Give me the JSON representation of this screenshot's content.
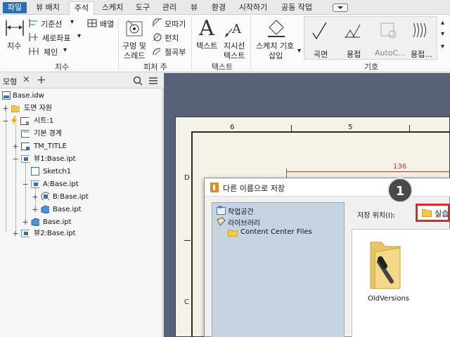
{
  "ribbon_tabs": [
    {
      "label": "파일",
      "active": false,
      "file": true
    },
    {
      "label": "뷰 배치",
      "active": false
    },
    {
      "label": "주석",
      "active": true
    },
    {
      "label": "스케치",
      "active": false
    },
    {
      "label": "도구",
      "active": false
    },
    {
      "label": "관리",
      "active": false
    },
    {
      "label": "뷰",
      "active": false
    },
    {
      "label": "환경",
      "active": false
    },
    {
      "label": "시작하기",
      "active": false
    },
    {
      "label": "공동 작업",
      "active": false
    }
  ],
  "ribbon": {
    "dimension": {
      "big_button": "치수",
      "baseline": "기준선",
      "ordinate": "세로좌표",
      "chain": "체인",
      "arrange": "배열",
      "group": "치수"
    },
    "feature_notes": {
      "hole_thread_1": "구멍 및",
      "hole_thread_2": "스레드",
      "chamfer": "모따기",
      "punch": "펀치",
      "bend": "절곡부",
      "group": "피처 주"
    },
    "text": {
      "text": "텍스트",
      "leader_1": "지시선",
      "leader_2": "텍스트",
      "group": "텍스트"
    },
    "symbols": {
      "sketch_symbol_1": "스케치 기호",
      "sketch_symbol_2": "삽입",
      "surface": "곡면",
      "weld": "용접",
      "autocad": "AutoC...",
      "weld_bead": "용접...",
      "group": "기호"
    }
  },
  "panel": {
    "tab_label": "모형",
    "tree": [
      {
        "label": "Base.idw",
        "indent": 0,
        "expander": "",
        "icon": "drawing-icon"
      },
      {
        "label": "도면 자원",
        "indent": 1,
        "expander": "+",
        "icon": "folder-icon"
      },
      {
        "label": "시트:1",
        "indent": 1,
        "expander": "−",
        "icon": "sheet-icon"
      },
      {
        "label": "기본 경계",
        "indent": 2,
        "expander": "",
        "icon": "border-icon"
      },
      {
        "label": "TM_TITLE",
        "indent": 2,
        "expander": "+",
        "icon": "titleblock-icon"
      },
      {
        "label": "뷰1:Base.ipt",
        "indent": 2,
        "expander": "−",
        "icon": "view-icon"
      },
      {
        "label": "Sketch1",
        "indent": 3,
        "expander": "",
        "icon": "sketch-icon"
      },
      {
        "label": "A:Base.ipt",
        "indent": 3,
        "expander": "−",
        "icon": "view-icon"
      },
      {
        "label": "B:Base.ipt",
        "indent": 4,
        "expander": "+",
        "icon": "section-view-icon"
      },
      {
        "label": "Base.ipt",
        "indent": 4,
        "expander": "+",
        "icon": "part-icon"
      },
      {
        "label": "Base.ipt",
        "indent": 3,
        "expander": "+",
        "icon": "part-icon"
      },
      {
        "label": "뷰2:Base.ipt",
        "indent": 2,
        "expander": "+",
        "icon": "view-icon"
      }
    ]
  },
  "drawing": {
    "zone_top": [
      "6",
      "5"
    ],
    "zone_left": [
      "D",
      "C"
    ],
    "dimension_value": "136"
  },
  "dialog": {
    "title": "다른 이름으로 저장",
    "locations": [
      "작업공간",
      "라이브러리",
      "Content Center Files"
    ],
    "save_location_label": "저장 위치(I):",
    "save_location_value": "실습",
    "folders": [
      "OldVersions"
    ]
  },
  "callout_number": "1",
  "colors": {
    "file_tab": "#2b6fb3",
    "canvas": "#56627a",
    "highlight": "#d42a2a",
    "dimension": "#c0392b"
  }
}
